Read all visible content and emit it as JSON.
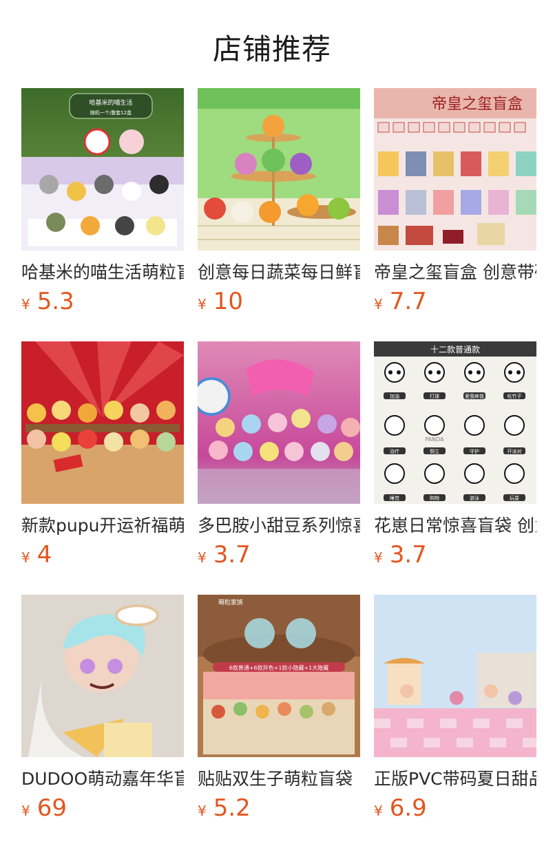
{
  "header": {
    "title": "店铺推荐"
  },
  "currency_symbol": "¥",
  "products": [
    {
      "name": "哈基米的喵生活萌粒盲盒",
      "price": "5.3",
      "image_text": [
        "哈基米的喵生活",
        "随机一个/整套12盒"
      ]
    },
    {
      "name": "创意每日蔬菜每日鲜盲盒",
      "price": "10",
      "image_text": []
    },
    {
      "name": "帝皇之玺盲盒 创意带码",
      "price": "7.7",
      "image_text": [
        "帝皇之玺盲盒"
      ]
    },
    {
      "name": "新款pupu开运祈福萌粒",
      "price": "4",
      "image_text": []
    },
    {
      "name": "多巴胺小甜豆系列惊喜",
      "price": "3.7",
      "image_text": []
    },
    {
      "name": "花崽日常惊喜盲袋 创意",
      "price": "3.7",
      "image_text": [
        "十二款普通款",
        "加油",
        "打球",
        "爱我疼我",
        "吃竹子",
        "治疗",
        "倒立",
        "守护",
        "开派对",
        "PANDA",
        "睡觉",
        "购物",
        "游泳",
        "玩耍"
      ]
    },
    {
      "name": "DUDOO萌动嘉年华盲盒",
      "price": "69",
      "image_text": []
    },
    {
      "name": "贴贴双生子萌粒盲袋",
      "price": "5.2",
      "image_text": [
        "6款普通+6款异色+1款小隐藏+1大隐藏",
        "萌粒家族"
      ]
    },
    {
      "name": "正版PVC带码夏日甜品",
      "price": "6.9",
      "image_text": []
    }
  ],
  "colors": {
    "price": "#e2561f",
    "title": "#1a1a1a",
    "name": "#2b2b2b"
  }
}
